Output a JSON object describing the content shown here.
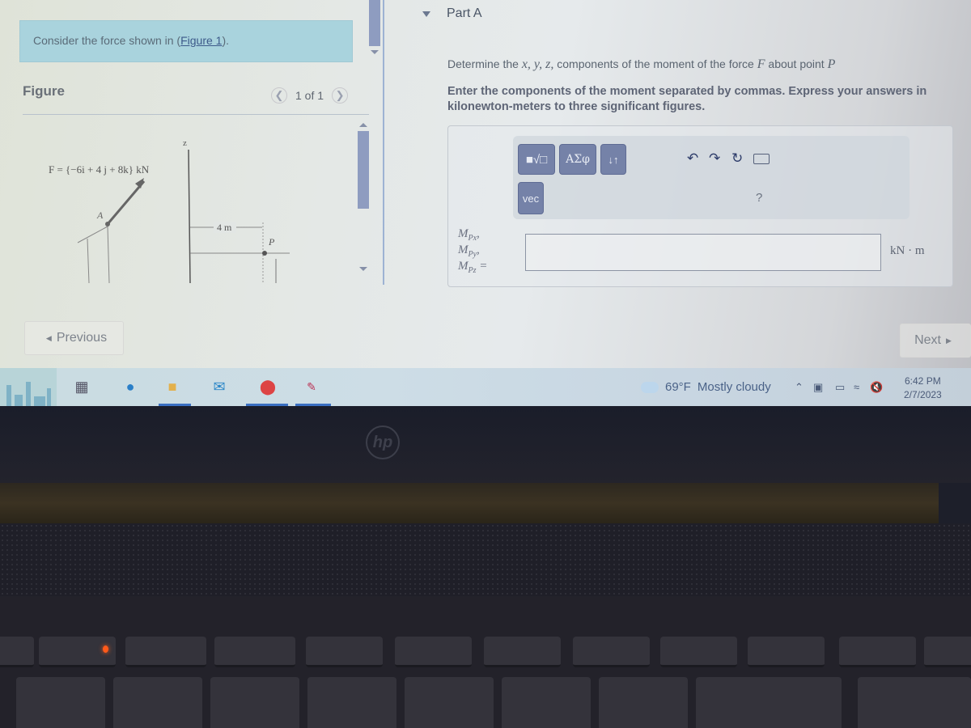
{
  "intro": {
    "text_before": "Consider the force shown in (",
    "link": "Figure 1",
    "text_after": ")."
  },
  "figure": {
    "label": "Figure",
    "pager": "1 of 1",
    "force_label": "F = {−6i + 4 j + 8k} kN",
    "axis_z": "z",
    "point_a": "A",
    "point_p": "P",
    "dimension": "4 m"
  },
  "part": {
    "title": "Part A",
    "question_before": "Determine the ",
    "question_vars": "x, y, z,",
    "question_mid": " components of the moment of the force ",
    "question_force": "F",
    "question_after": " about point ",
    "question_point": "P",
    "instructions": "Enter the components of the moment separated by commas. Express your answers in kilonewton-meters to three significant figures."
  },
  "toolbar": {
    "templates_icon": "■√□",
    "symbols_label": "ΑΣφ",
    "arrows_label": "↓↑",
    "vec_label": "vec",
    "help_label": "?"
  },
  "answer": {
    "label_x": "M",
    "label_x_sub": "Px",
    "label_y": "M",
    "label_y_sub": "Py",
    "label_z": "M",
    "label_z_sub": "Pz",
    "equals": "=",
    "value": "",
    "unit": "kN · m"
  },
  "navigation": {
    "previous": "Previous",
    "next": "Next"
  },
  "taskbar": {
    "weather_temp": "69°F",
    "weather_text": "Mostly cloudy",
    "time": "6:42 PM",
    "date": "2/7/2023"
  },
  "laptop": {
    "brand": "hp"
  }
}
